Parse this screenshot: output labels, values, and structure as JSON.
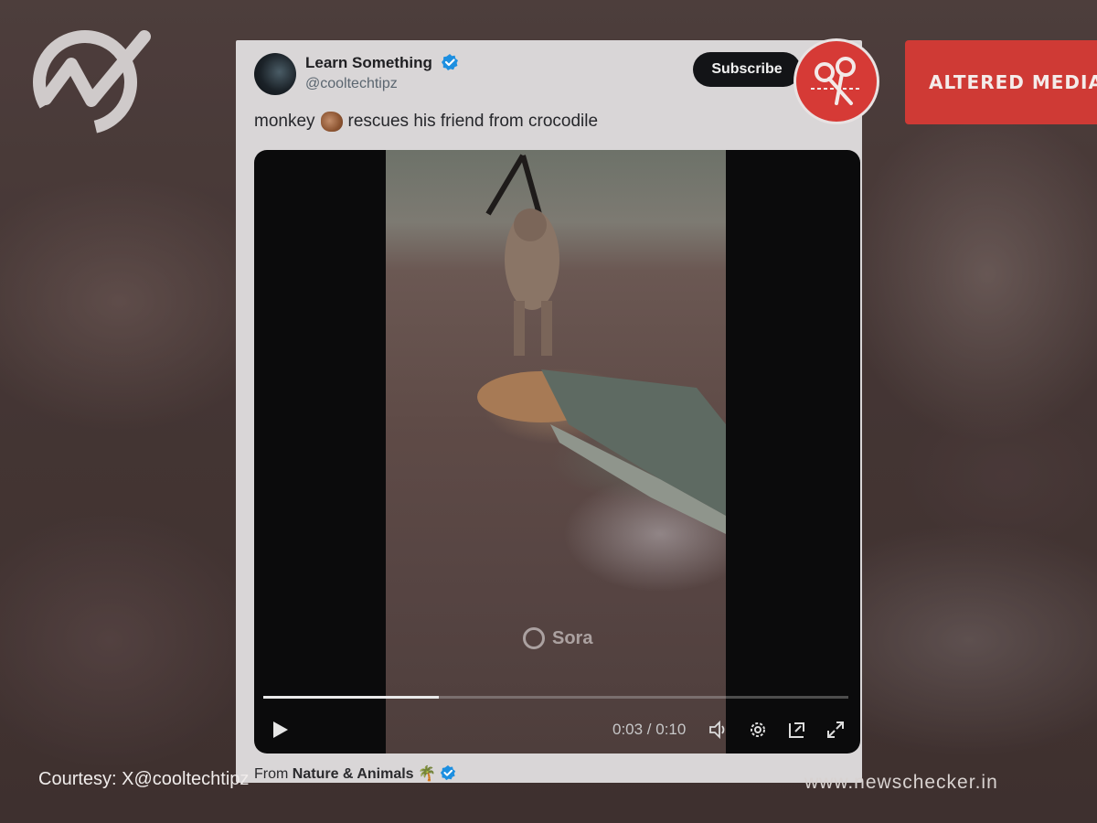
{
  "brand": {
    "logo_icon": "checkmark-graph-logo-icon"
  },
  "badge": {
    "label": "ALTERED MEDIA",
    "icon": "scissors-icon",
    "color": "#cf3a35"
  },
  "tweet": {
    "author_name": "Learn Something",
    "author_handle": "@cooltechtipz",
    "verified_icon": "verified-badge-icon",
    "subscribe_label": "Subscribe",
    "text_before": "monkey",
    "emoji": "monkey-emoji",
    "text_after": "rescues his friend from crocodile",
    "video": {
      "watermark": "Sora",
      "time_display": "0:03 / 0:10",
      "progress_fraction": 0.3,
      "controls": [
        "play-icon",
        "volume-icon",
        "settings-icon",
        "pip-icon",
        "fullscreen-icon"
      ]
    },
    "from_prefix": "From",
    "from_source": "Nature & Animals"
  },
  "footer": {
    "courtesy": "Courtesy: X@cooltechtipz",
    "site": "www.newschecker.in"
  }
}
